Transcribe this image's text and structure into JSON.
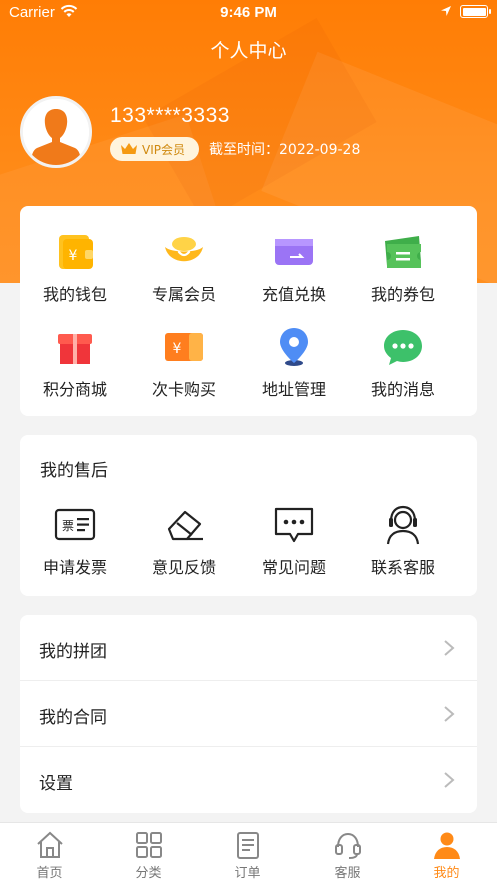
{
  "status_bar": {
    "carrier": "Carrier",
    "time": "9:46 PM"
  },
  "header": {
    "title": "个人中心"
  },
  "profile": {
    "phone": "133****3333",
    "vip_label": "VIP会员",
    "expire_text": "截至时间：2022-09-28"
  },
  "features": [
    {
      "label": "我的钱包",
      "icon": "wallet-icon"
    },
    {
      "label": "专属会员",
      "icon": "gold-ingot-icon"
    },
    {
      "label": "充值兑换",
      "icon": "card-icon"
    },
    {
      "label": "我的券包",
      "icon": "coupon-icon"
    },
    {
      "label": "积分商城",
      "icon": "gift-icon"
    },
    {
      "label": "次卡购买",
      "icon": "ticket-card-icon"
    },
    {
      "label": "地址管理",
      "icon": "location-pin-icon"
    },
    {
      "label": "我的消息",
      "icon": "message-bubble-icon"
    }
  ],
  "after_sales": {
    "title": "我的售后",
    "items": [
      {
        "label": "申请发票",
        "icon": "invoice-icon",
        "glyph": "票"
      },
      {
        "label": "意见反馈",
        "icon": "eraser-feedback-icon"
      },
      {
        "label": "常见问题",
        "icon": "faq-bubble-icon"
      },
      {
        "label": "联系客服",
        "icon": "headset-user-icon"
      }
    ]
  },
  "menu_list": [
    {
      "label": "我的拼团"
    },
    {
      "label": "我的合同"
    },
    {
      "label": "设置"
    }
  ],
  "tabbar": [
    {
      "label": "首页",
      "icon": "home-icon",
      "active": false
    },
    {
      "label": "分类",
      "icon": "grid-icon",
      "active": false
    },
    {
      "label": "订单",
      "icon": "document-icon",
      "active": false
    },
    {
      "label": "客服",
      "icon": "headset-icon",
      "active": false
    },
    {
      "label": "我的",
      "icon": "person-icon",
      "active": true
    }
  ],
  "colors": {
    "brand_orange": "#ff8a17",
    "vip_text": "#d08a10",
    "background": "#f3f3f3"
  }
}
